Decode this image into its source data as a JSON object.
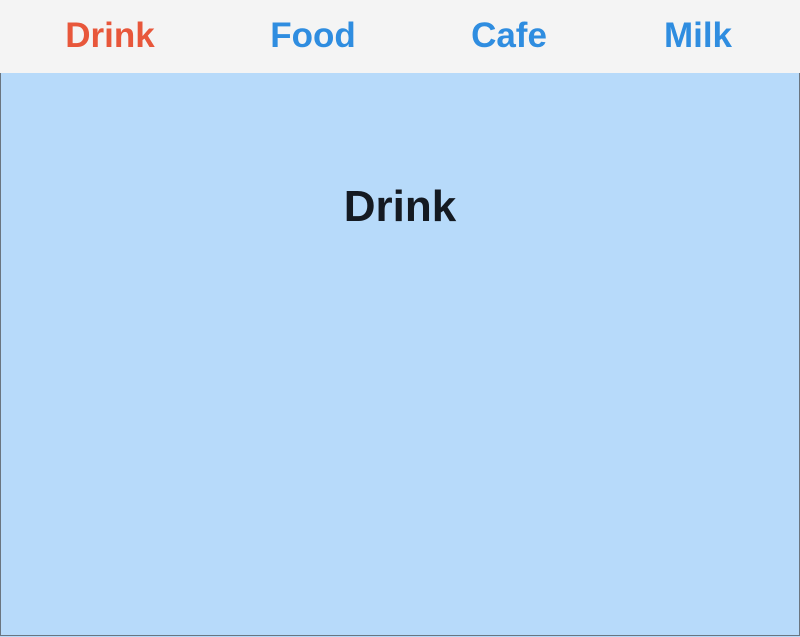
{
  "tabs": [
    {
      "label": "Drink",
      "active": true
    },
    {
      "label": "Food",
      "active": false
    },
    {
      "label": "Cafe",
      "active": false
    },
    {
      "label": "Milk",
      "active": false
    }
  ],
  "content": {
    "title": "Drink"
  },
  "colors": {
    "active_tab": "#e8573b",
    "inactive_tab": "#2f8de0",
    "tabbar_bg": "#f4f4f4",
    "content_bg": "#b7dafa"
  }
}
